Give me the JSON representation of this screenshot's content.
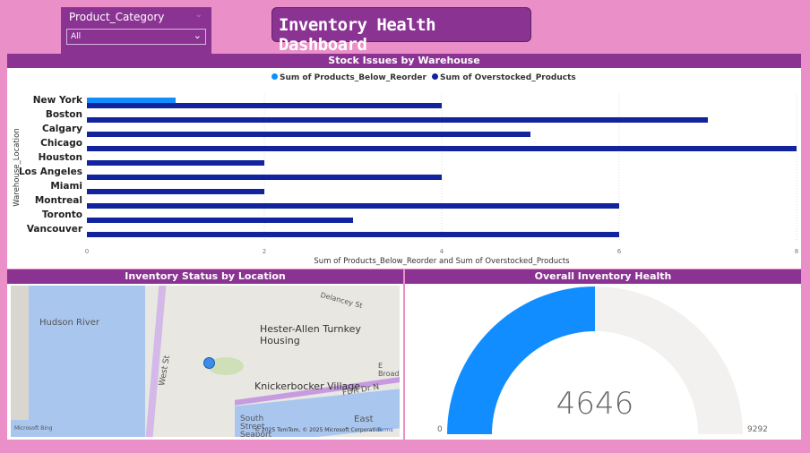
{
  "slicer": {
    "label": "Product_Category",
    "value": "All"
  },
  "header": {
    "title": "Inventory Health Dashboard"
  },
  "bar_chart": {
    "title": "Stock Issues by Warehouse"
  },
  "map": {
    "title": "Inventory Status by Location",
    "labels": [
      "Hudson River",
      "Hester-Allen Turnkey Housing",
      "Knickerbocker Village",
      "West St",
      "FDR Dr N",
      "E Broadway",
      "Delancey St",
      "East",
      "South Street Seaport"
    ],
    "logo": "Microsoft Bing",
    "copyright": "© 2025 TomTom, © 2025 Microsoft Corporation",
    "terms": "Terms"
  },
  "gauge": {
    "title": "Overall Inventory Health",
    "value": 4646,
    "value_label": "4646",
    "min": 0,
    "min_label": "0",
    "max": 9292,
    "max_label": "9292",
    "fill_color": "#118dff",
    "track_color": "#f2f1ef"
  },
  "chart_data": {
    "type": "bar",
    "orientation": "horizontal",
    "categories": [
      "New York",
      "Boston",
      "Calgary",
      "Chicago",
      "Houston",
      "Los Angeles",
      "Miami",
      "Montreal",
      "Toronto",
      "Vancouver"
    ],
    "series": [
      {
        "name": "Sum of Products_Below_Reorder",
        "color": "#118dff",
        "values": [
          1,
          0,
          0,
          0,
          0,
          0,
          0,
          0,
          0,
          0
        ]
      },
      {
        "name": "Sum of Overstocked_Products",
        "color": "#12239e",
        "values": [
          4,
          7,
          5,
          8,
          2,
          4,
          2,
          6,
          3,
          6
        ]
      }
    ],
    "xlabel": "Sum of Products_Below_Reorder and Sum of Overstocked_Products",
    "ylabel": "Warehouse_Location",
    "xlim": [
      0,
      8
    ],
    "xticks": [
      "0",
      "2",
      "4",
      "6",
      "8"
    ],
    "grid": true,
    "legend": "top"
  }
}
